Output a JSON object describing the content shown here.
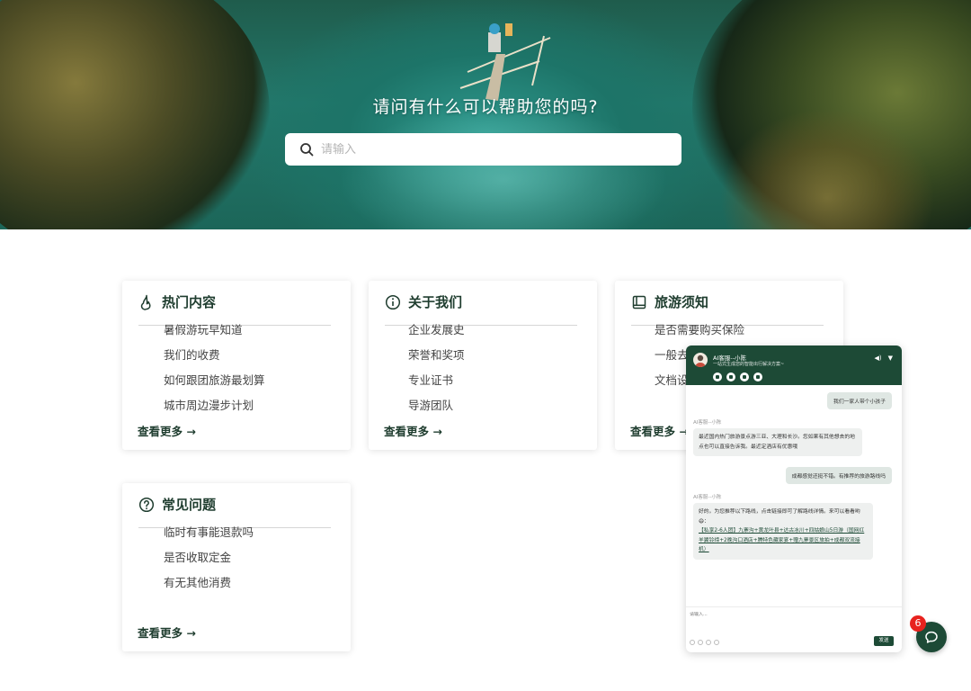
{
  "hero": {
    "title": "请问有什么可以帮助您的吗?",
    "search_placeholder": "请输入"
  },
  "cards": [
    {
      "title": "热门内容",
      "icon": "flame-icon",
      "items": [
        "暑假游玩早知道",
        "我们的收费",
        "如何跟团旅游最划算",
        "城市周边漫步计划"
      ],
      "more": "查看更多 →"
    },
    {
      "title": "关于我们",
      "icon": "info-icon",
      "items": [
        "企业发展史",
        "荣誉和奖项",
        "专业证书",
        "导游团队"
      ],
      "more": "查看更多 →"
    },
    {
      "title": "旅游须知",
      "icon": "book-icon",
      "items": [
        "是否需要购买保险",
        "一般去",
        "文档设"
      ],
      "more": "查看更多 →"
    },
    {
      "title": "常见问题",
      "icon": "question-icon",
      "items": [
        "临时有事能退款吗",
        "是否收取定金",
        "有无其他消费"
      ],
      "more": "查看更多 →"
    }
  ],
  "chat": {
    "name": "AI客服--小陈",
    "subtitle": "一站式生成您的智能出行解决方案~",
    "messages": [
      {
        "from": "user",
        "text": "我们一家人带个小孩子"
      },
      {
        "from": "bot",
        "label": "AI客服--小陈",
        "text": "最近国内热门旅游景点游三亚、大理和长沙。您如果有其他想去的地点也可以直接告诉我。最近定酒店有优惠哦"
      },
      {
        "from": "user",
        "text": "成都感觉还挺不错。有推荐的旅游路线吗"
      },
      {
        "from": "bot",
        "label": "AI客服--小陈",
        "text": "好的。为您推荐以下路线，点击链接即可了解路线详情。来可以看看哟😄：",
        "link": "【私享2-6人团】九寨沟+黄龙叶县+达古冰川+四姑娘山5日游（国网红羊翼铃缔+2晚沟口酒店+腾特色藏家宴+赠九寨景区旅拍+成都双流接机）"
      }
    ],
    "input_placeholder": "请输入...",
    "send_label": "发送"
  },
  "fab": {
    "badge": "6"
  }
}
